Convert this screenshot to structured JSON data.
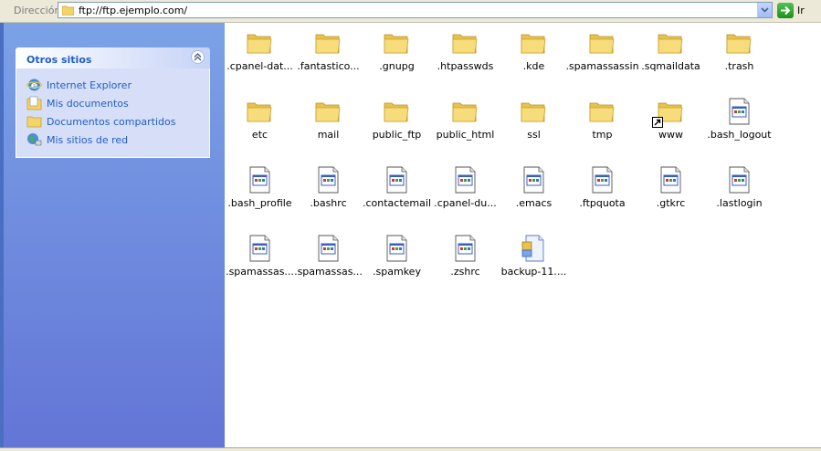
{
  "address": {
    "label": "Dirección",
    "url": "ftp://ftp.ejemplo.com/",
    "go_label": "Ir"
  },
  "sidebar": {
    "title": "Otros sitios",
    "items": [
      {
        "label": "Internet Explorer",
        "icon": "ie-icon"
      },
      {
        "label": "Mis documentos",
        "icon": "my-documents-icon"
      },
      {
        "label": "Documentos compartidos",
        "icon": "shared-folder-icon"
      },
      {
        "label": "Mis sitios de red",
        "icon": "network-places-icon"
      }
    ]
  },
  "files": [
    {
      "name": ".cpanel-dat...",
      "type": "folder"
    },
    {
      "name": ".fantastico...",
      "type": "folder"
    },
    {
      "name": ".gnupg",
      "type": "folder"
    },
    {
      "name": ".htpasswds",
      "type": "folder"
    },
    {
      "name": ".kde",
      "type": "folder"
    },
    {
      "name": ".spamassassin",
      "type": "folder"
    },
    {
      "name": ".sqmaildata",
      "type": "folder"
    },
    {
      "name": ".trash",
      "type": "folder"
    },
    {
      "name": "etc",
      "type": "folder"
    },
    {
      "name": "mail",
      "type": "folder"
    },
    {
      "name": "public_ftp",
      "type": "folder"
    },
    {
      "name": "public_html",
      "type": "folder"
    },
    {
      "name": "ssl",
      "type": "folder"
    },
    {
      "name": "tmp",
      "type": "folder"
    },
    {
      "name": "www",
      "type": "folder-shortcut"
    },
    {
      "name": ".bash_logout",
      "type": "file"
    },
    {
      "name": ".bash_profile",
      "type": "file"
    },
    {
      "name": ".bashrc",
      "type": "file"
    },
    {
      "name": ".contactemail",
      "type": "file"
    },
    {
      "name": ".cpanel-du...",
      "type": "file"
    },
    {
      "name": ".emacs",
      "type": "file"
    },
    {
      "name": ".ftpquota",
      "type": "file"
    },
    {
      "name": ".gtkrc",
      "type": "file"
    },
    {
      "name": ".lastlogin",
      "type": "file"
    },
    {
      "name": ".spamassas...",
      "type": "file"
    },
    {
      "name": ".spamassas...",
      "type": "file"
    },
    {
      "name": ".spamkey",
      "type": "file"
    },
    {
      "name": ".zshrc",
      "type": "file"
    },
    {
      "name": "backup-11....",
      "type": "archive"
    }
  ]
}
